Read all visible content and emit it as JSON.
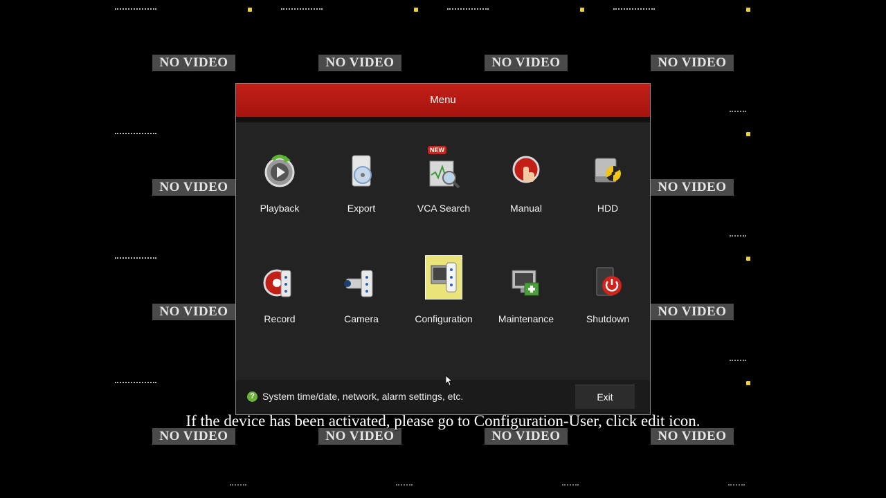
{
  "camera_grid": {
    "no_video_label": "NO VIDEO"
  },
  "menu": {
    "title": "Menu",
    "items": [
      {
        "label": "Playback",
        "icon": "playback-icon"
      },
      {
        "label": "Export",
        "icon": "export-icon"
      },
      {
        "label": "VCA Search",
        "icon": "vca-search-icon",
        "badge": "NEW"
      },
      {
        "label": "Manual",
        "icon": "manual-icon"
      },
      {
        "label": "HDD",
        "icon": "hdd-icon"
      },
      {
        "label": "Record",
        "icon": "record-icon"
      },
      {
        "label": "Camera",
        "icon": "camera-icon"
      },
      {
        "label": "Configuration",
        "icon": "configuration-icon",
        "selected": true
      },
      {
        "label": "Maintenance",
        "icon": "maintenance-icon"
      },
      {
        "label": "Shutdown",
        "icon": "shutdown-icon"
      }
    ],
    "hint": "System time/date, network, alarm settings, etc.",
    "exit_label": "Exit"
  },
  "subtitle": "If the device has been activated, please go to Configuration-User, click edit icon.",
  "colors": {
    "header_red": "#b81a12",
    "panel_bg": "#232323",
    "selected_tile": "#e9e37a",
    "hint_green": "#6bb23a"
  }
}
